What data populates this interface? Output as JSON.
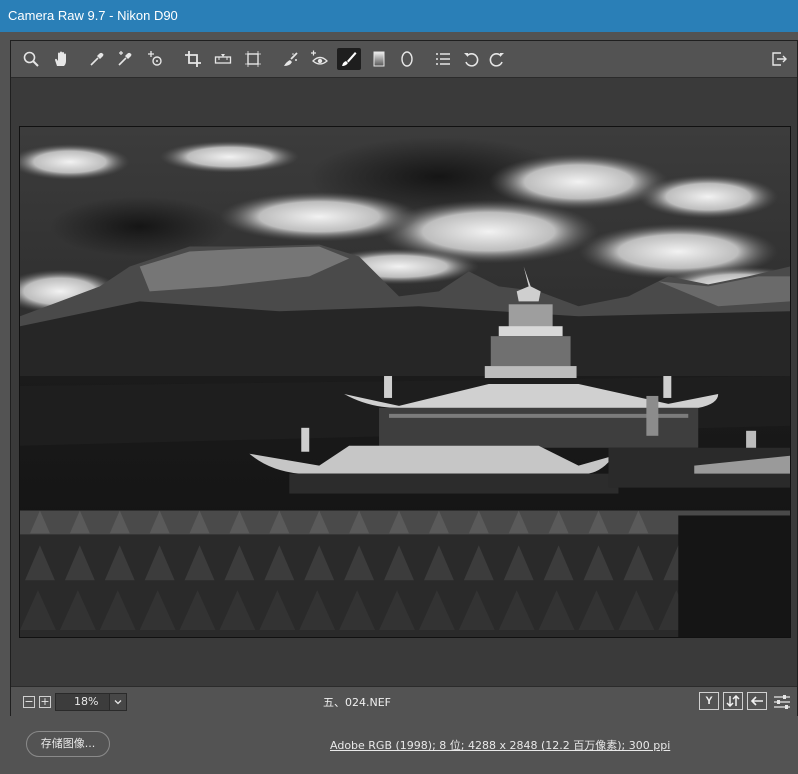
{
  "window": {
    "title": "Camera Raw 9.7 -  Nikon D90"
  },
  "toolbar": {
    "tools": [
      {
        "name": "zoom-tool",
        "icon": "magnifier-icon"
      },
      {
        "name": "hand-tool",
        "icon": "hand-icon"
      },
      {
        "name": "white-balance-tool",
        "icon": "eyedropper-icon"
      },
      {
        "name": "color-sampler-tool",
        "icon": "eyedropper-plus-icon"
      },
      {
        "name": "targeted-adjustment-tool",
        "icon": "target-icon"
      },
      {
        "name": "crop-tool",
        "icon": "crop-icon"
      },
      {
        "name": "straighten-tool",
        "icon": "level-icon"
      },
      {
        "name": "transform-tool",
        "icon": "transform-icon"
      },
      {
        "name": "spot-removal-tool",
        "icon": "brush-spot-icon"
      },
      {
        "name": "red-eye-tool",
        "icon": "eye-icon"
      },
      {
        "name": "adjustment-brush-tool",
        "icon": "brush-icon",
        "active": true
      },
      {
        "name": "graduated-filter-tool",
        "icon": "gradient-icon"
      },
      {
        "name": "radial-filter-tool",
        "icon": "ellipse-icon"
      },
      {
        "name": "preferences",
        "icon": "list-icon"
      },
      {
        "name": "rotate-ccw",
        "icon": "rotate-left-icon"
      },
      {
        "name": "rotate-cw",
        "icon": "rotate-right-icon"
      },
      {
        "name": "full-screen",
        "icon": "fullscreen-icon"
      }
    ]
  },
  "status": {
    "zoom_minus": "−",
    "zoom_plus": "+",
    "zoom_value": "18%",
    "filename": "五、024.NEF",
    "before_after": "Y"
  },
  "footer": {
    "save_label": "存储图像...",
    "workflow_label": "Adobe RGB (1998); 8 位; 4288 x 2848 (12.2 百万像素); 300 ppi"
  },
  "colors": {
    "titlebar": "#2a7fb7",
    "panel": "#535353",
    "canvas": "#3a3a3a",
    "active_tool": "#1e1e1e"
  }
}
